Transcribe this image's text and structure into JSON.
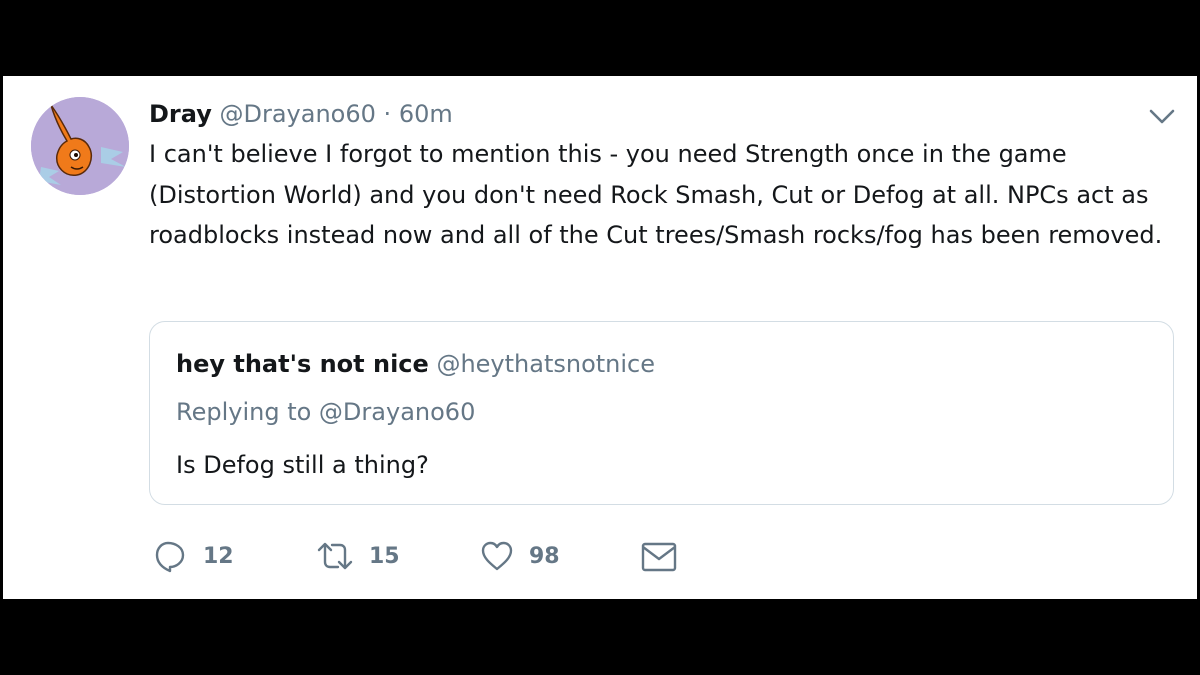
{
  "tweet": {
    "author_name": "Dray",
    "author_handle": "@Drayano60",
    "separator": "·",
    "time": "60m",
    "text": "I can't believe I forgot to mention this - you need Strength once in the game (Distortion World) and you don't need Rock Smash, Cut or Defog at all. NPCs act as roadblocks instead now and all of the Cut trees/Smash rocks/fog has been removed."
  },
  "quoted_tweet": {
    "author_name": "hey that's not nice",
    "author_handle": "@heythatsnotnice",
    "replying_to": "Replying to @Drayano60",
    "text": "Is Defog still a thing?"
  },
  "actions": {
    "replies": "12",
    "retweets": "15",
    "likes": "98"
  },
  "icons": {
    "reply": "reply-bubble-icon",
    "retweet": "retweet-icon",
    "like": "heart-icon",
    "dm": "envelope-icon",
    "menu": "chevron-down-icon"
  },
  "colors": {
    "background": "#000000",
    "card": "#ffffff",
    "text_primary": "#14171a",
    "text_secondary": "#657786",
    "quote_border": "#d3dde4",
    "avatar_bg": "#b8a9d8",
    "avatar_character": "#f07a1a"
  }
}
